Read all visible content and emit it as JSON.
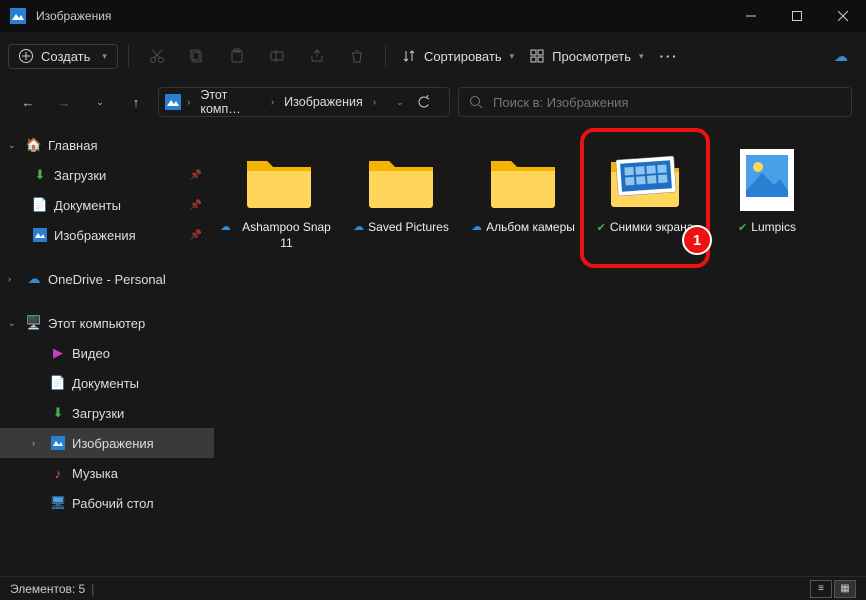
{
  "window": {
    "title": "Изображения"
  },
  "toolbar": {
    "new_label": "Создать",
    "sort_label": "Сортировать",
    "view_label": "Просмотреть"
  },
  "breadcrumb": {
    "items": [
      "Этот комп…",
      "Изображения"
    ]
  },
  "search": {
    "placeholder": "Поиск в: Изображения"
  },
  "nav": {
    "home": "Главная",
    "downloads": "Загрузки",
    "documents": "Документы",
    "pictures": "Изображения",
    "onedrive": "OneDrive - Personal",
    "thispc": "Этот компьютер",
    "video": "Видео",
    "documents2": "Документы",
    "downloads2": "Загрузки",
    "pictures2": "Изображения",
    "music": "Музыка",
    "desktop": "Рабочий стол"
  },
  "items": [
    {
      "name": "Ashampoo Snap 11",
      "status": "cloud"
    },
    {
      "name": "Saved Pictures",
      "status": "cloud"
    },
    {
      "name": "Альбом камеры",
      "status": "cloud"
    },
    {
      "name": "Снимки экрана",
      "status": "sync",
      "highlighted": true,
      "thumb": true
    },
    {
      "name": "Lumpics",
      "status": "sync",
      "type": "file"
    }
  ],
  "status": {
    "count_label": "Элементов: 5"
  },
  "annotation": {
    "number": "1"
  }
}
